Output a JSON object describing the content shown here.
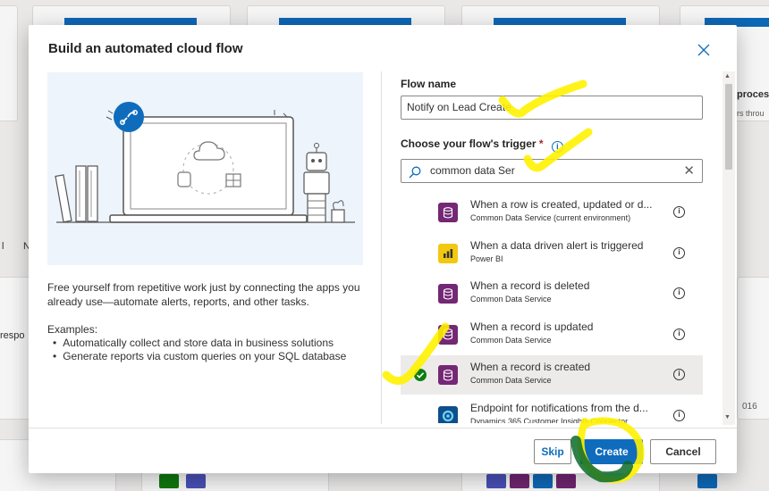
{
  "background": {
    "cards_top": [
      "",
      "",
      "",
      ""
    ],
    "right_card_title": "proces",
    "right_card_sub": "rs throu",
    "left_fragment_1": "l",
    "left_fragment_2": "N",
    "left_fragment_3": "respo",
    "right_fragment_year": "016"
  },
  "dialog": {
    "title": "Build an automated cloud flow",
    "close_icon": "close-icon",
    "description": "Free yourself from repetitive work just by connecting the apps you already use—automate alerts, reports, and other tasks.",
    "examples_heading": "Examples:",
    "examples": [
      "Automatically collect and store data in business solutions",
      "Generate reports via custom queries on your SQL database"
    ],
    "flow_name_label": "Flow name",
    "flow_name_value": "Notify on Lead Create",
    "trigger_label": "Choose your flow's trigger",
    "required_mark": "*",
    "info_glyph": "i",
    "search_value": "common data Ser",
    "clear_glyph": "✕",
    "triggers": [
      {
        "name": "When a row is created, updated or d...",
        "sub": "Common Data Service (current environment)",
        "icon_color": "#742774",
        "icon": "database-icon",
        "selected": false
      },
      {
        "name": "When a data driven alert is triggered",
        "sub": "Power BI",
        "icon_color": "#f2c811",
        "icon": "powerbi-icon",
        "selected": false
      },
      {
        "name": "When a record is deleted",
        "sub": "Common Data Service",
        "icon_color": "#742774",
        "icon": "database-icon",
        "selected": false
      },
      {
        "name": "When a record is updated",
        "sub": "Common Data Service",
        "icon_color": "#742774",
        "icon": "database-icon",
        "selected": false
      },
      {
        "name": "When a record is created",
        "sub": "Common Data Service",
        "icon_color": "#742774",
        "icon": "database-icon",
        "selected": true
      },
      {
        "name": "Endpoint for notifications from the d...",
        "sub": "Dynamics 365 Customer Insights Connector",
        "icon_color": "#0f4f8a",
        "icon": "customer-insights-icon",
        "selected": false
      }
    ],
    "buttons": {
      "skip": "Skip",
      "create": "Create",
      "cancel": "Cancel"
    },
    "accent": "#0f6cbd",
    "annotation_color": "#fff200"
  }
}
